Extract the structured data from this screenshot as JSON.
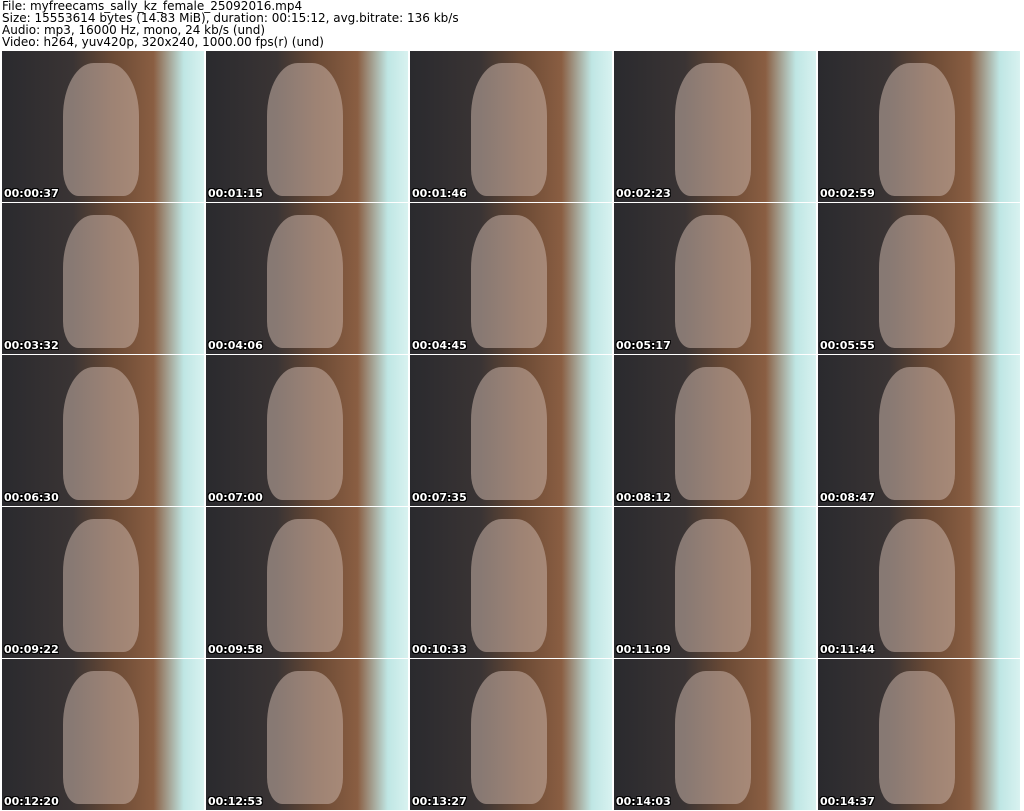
{
  "info": {
    "file": "File: myfreecams_sally_kz_female_25092016.mp4",
    "size": "Size: 15553614 bytes (14.83 MiB), duration: 00:15:12, avg.bitrate: 136 kb/s",
    "audio": "Audio: mp3, 16000 Hz, mono, 24 kb/s (und)",
    "video": "Video: h264, yuv420p, 320x240, 1000.00 fps(r) (und)"
  },
  "thumbnails": [
    "00:00:37",
    "00:01:15",
    "00:01:46",
    "00:02:23",
    "00:02:59",
    "00:03:32",
    "00:04:06",
    "00:04:45",
    "00:05:17",
    "00:05:55",
    "00:06:30",
    "00:07:00",
    "00:07:35",
    "00:08:12",
    "00:08:47",
    "00:09:22",
    "00:09:58",
    "00:10:33",
    "00:11:09",
    "00:11:44",
    "00:12:20",
    "00:12:53",
    "00:13:27",
    "00:14:03",
    "00:14:37"
  ]
}
